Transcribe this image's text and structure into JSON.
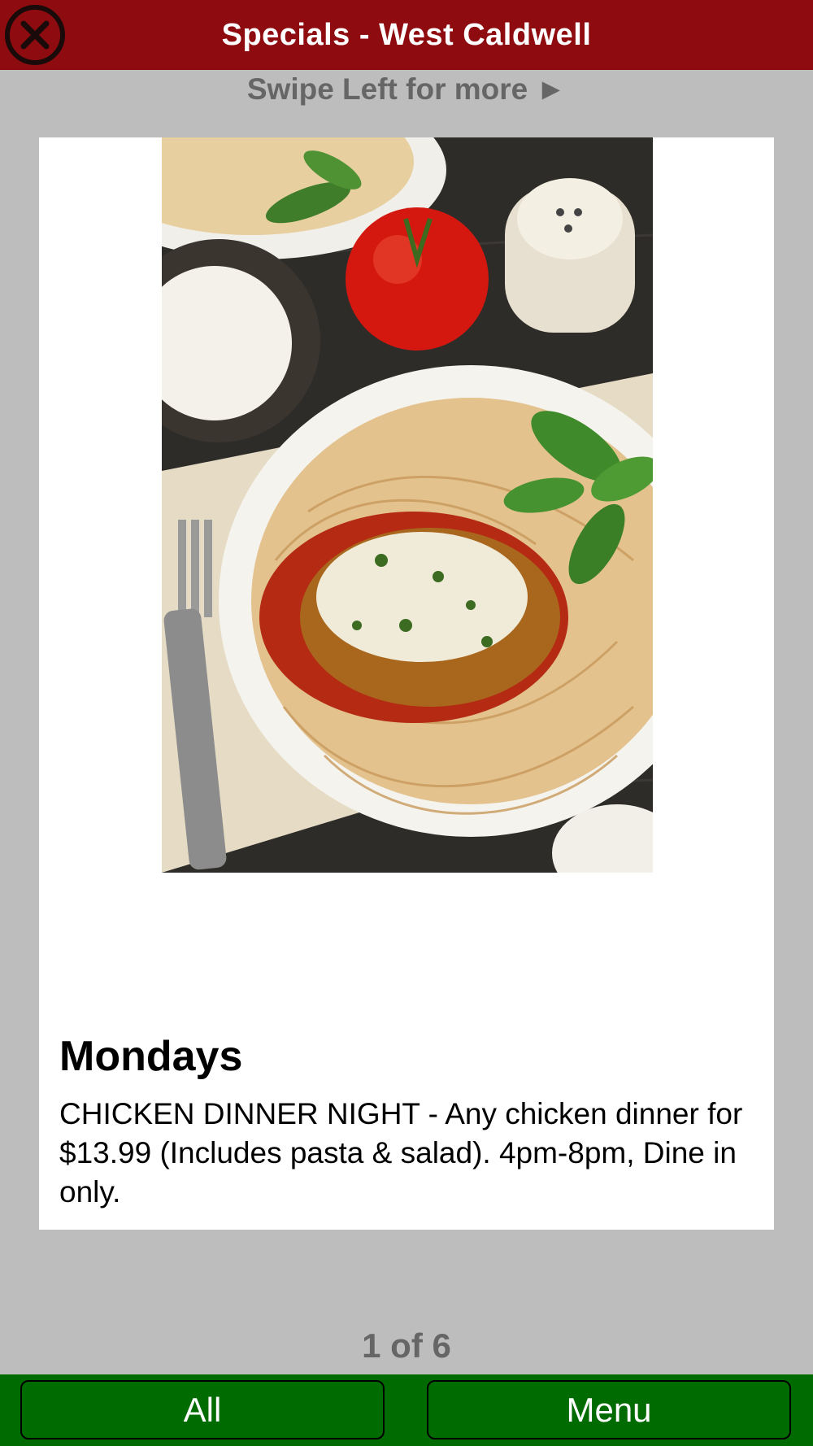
{
  "header": {
    "title": "Specials - West Caldwell",
    "close_icon": "close-circle-icon"
  },
  "swipe_hint": "Swipe Left for more ►",
  "special": {
    "image_description_icon": "chicken-parmesan-photo",
    "day": "Mondays",
    "description": "CHICKEN DINNER NIGHT - Any chicken dinner for $13.99 (Includes pasta & salad). 4pm-8pm, Dine in only."
  },
  "pager": "1 of 6",
  "footer": {
    "all_label": "All",
    "menu_label": "Menu"
  },
  "colors": {
    "header_bg": "#8e0c10",
    "footer_bg": "#006b00",
    "page_bg": "#bdbdbd"
  }
}
